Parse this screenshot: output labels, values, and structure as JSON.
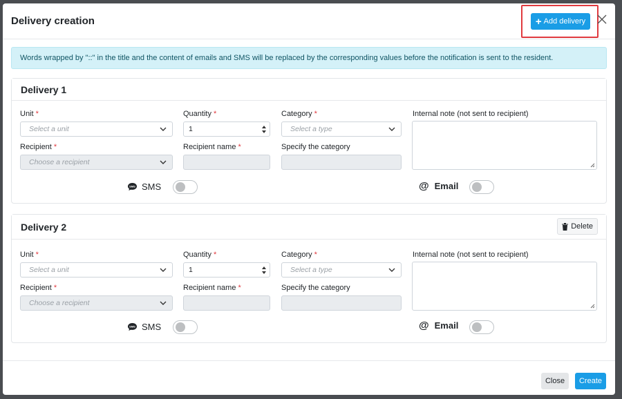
{
  "modal": {
    "title": "Delivery creation",
    "add_delivery_label": "Add delivery",
    "info_message": "Words wrapped by \"::\" in the title and the content of emails and SMS will be replaced by the corresponding values before the notification is sent to the resident."
  },
  "deliveries": [
    {
      "title": "Delivery 1",
      "unit": {
        "label": "Unit",
        "placeholder": "Select a unit"
      },
      "quantity": {
        "label": "Quantity",
        "value": "1"
      },
      "category": {
        "label": "Category",
        "placeholder": "Select a type"
      },
      "internal_note": {
        "label": "Internal note (not sent to recipient)",
        "value": ""
      },
      "recipient": {
        "label": "Recipient",
        "placeholder": "Choose a recipient"
      },
      "recipient_name": {
        "label": "Recipient name",
        "value": ""
      },
      "specify_category": {
        "label": "Specify the category",
        "value": ""
      },
      "sms": {
        "label": "SMS",
        "enabled": false
      },
      "email": {
        "label": "Email",
        "enabled": false
      }
    },
    {
      "title": "Delivery 2",
      "delete_label": "Delete",
      "unit": {
        "label": "Unit",
        "placeholder": "Select a unit"
      },
      "quantity": {
        "label": "Quantity",
        "value": "1"
      },
      "category": {
        "label": "Category",
        "placeholder": "Select a type"
      },
      "internal_note": {
        "label": "Internal note (not sent to recipient)",
        "value": ""
      },
      "recipient": {
        "label": "Recipient",
        "placeholder": "Choose a recipient"
      },
      "recipient_name": {
        "label": "Recipient name",
        "value": ""
      },
      "specify_category": {
        "label": "Specify the category",
        "value": ""
      },
      "sms": {
        "label": "SMS",
        "enabled": false
      },
      "email": {
        "label": "Email",
        "enabled": false
      }
    }
  ],
  "footer": {
    "close_label": "Close",
    "create_label": "Create"
  },
  "colors": {
    "primary": "#1a9de6",
    "required": "#e0393e",
    "info_bg": "#d4f1f8",
    "highlight": "#e0393e"
  },
  "icons": [
    "plus-icon",
    "close-icon",
    "chevron-down-icon",
    "sms-icon",
    "at-icon",
    "trash-icon",
    "resize-grip-icon",
    "stepper-icon"
  ]
}
